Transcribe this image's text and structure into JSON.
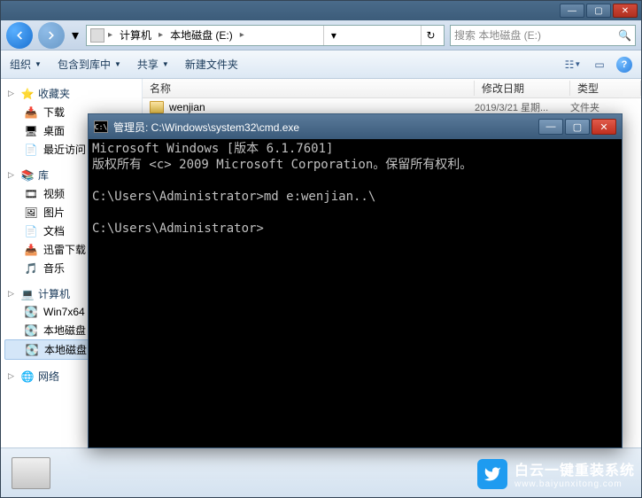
{
  "explorer": {
    "breadcrumbs": [
      "计算机",
      "本地磁盘 (E:)"
    ],
    "search_placeholder": "搜索 本地磁盘 (E:)",
    "toolbar": {
      "organize": "组织",
      "include": "包含到库中",
      "share": "共享",
      "newfolder": "新建文件夹"
    },
    "columns": {
      "name": "名称",
      "date": "修改日期",
      "type": "类型"
    },
    "files": [
      {
        "name": "wenjian",
        "date": "2019/3/21 星期...",
        "type": "文件夹"
      }
    ],
    "sidebar": {
      "favorites": "收藏夹",
      "fav_items": [
        "下载",
        "桌面",
        "最近访问"
      ],
      "libraries": "库",
      "lib_items": [
        "视频",
        "图片",
        "文档",
        "迅雷下载",
        "音乐"
      ],
      "computer": "计算机",
      "comp_items": [
        "Win7x64",
        "本地磁盘",
        "本地磁盘"
      ],
      "network": "网络"
    }
  },
  "cmd": {
    "title": "管理员: C:\\Windows\\system32\\cmd.exe",
    "lines": [
      "Microsoft Windows [版本 6.1.7601]",
      "版权所有 <c> 2009 Microsoft Corporation。保留所有权利。",
      "",
      "C:\\Users\\Administrator>md e:wenjian..\\",
      "",
      "C:\\Users\\Administrator>"
    ]
  },
  "watermark": {
    "line1": "白云一键重装系统",
    "line2": "www.baiyunxitong.com"
  }
}
